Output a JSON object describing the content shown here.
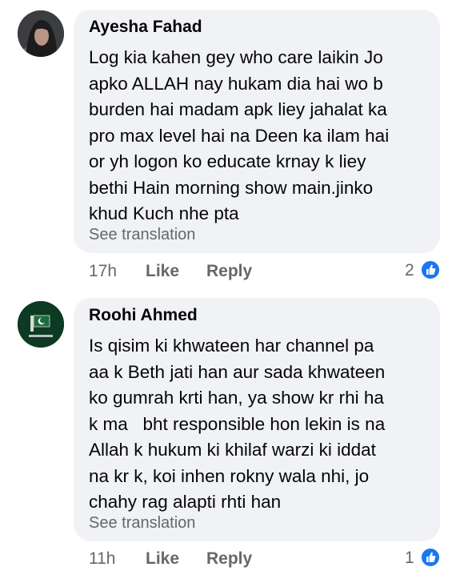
{
  "comments": [
    {
      "author": "Ayesha Fahad",
      "lines": [
        "Log kia kahen gey who care laikin Jo",
        "apko ALLAH nay hukam dia hai wo b",
        "burden hai madam apk liey jahalat ka",
        "pro max level hai na Deen ka ilam hai",
        "or yh logon ko educate krnay k liey",
        "bethi Hain morning show main.jinko",
        "khud Kuch nhe pta"
      ],
      "see_translation": "See translation",
      "time": "17h",
      "like_label": "Like",
      "reply_label": "Reply",
      "reaction_count": "2",
      "reaction_icon": "like-thumbs-up-icon"
    },
    {
      "author": "Roohi Ahmed",
      "lines": [
        "Is qisim ki khwateen har channel pa",
        "aa k Beth jati han aur sada khwateen",
        "ko gumrah krti han, ya show kr rhi ha",
        "k ma   bht responsible hon lekin is na",
        "Allah k hukum ki khilaf warzi ki iddat",
        "na kr k, koi inhen rokny wala nhi, jo",
        "chahy rag alapti rhti han"
      ],
      "see_translation": "See translation",
      "time": "11h",
      "like_label": "Like",
      "reply_label": "Reply",
      "reaction_count": "1",
      "reaction_icon": "like-thumbs-up-icon"
    }
  ],
  "colors": {
    "bubble": "#f0f2f5",
    "text": "#050505",
    "secondary": "#65676b",
    "like_blue": "#1877f2"
  }
}
